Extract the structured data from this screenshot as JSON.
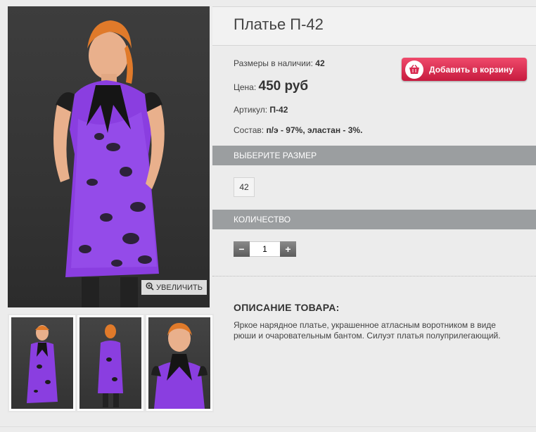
{
  "product": {
    "title": "Платье П-42",
    "sizes_label": "Размеры в наличии:",
    "sizes_value": "42",
    "price_label": "Цена:",
    "price_value": "450 руб",
    "article_label": "Артикул:",
    "article_value": "П-42",
    "composition_label": "Состав:",
    "composition_value": "п/э - 97%, эластан - 3%."
  },
  "cart": {
    "button_label": "Добавить в корзину",
    "icon": "basket-icon"
  },
  "gallery": {
    "zoom_label": "УВЕЛИЧИТЬ",
    "zoom_icon": "magnifier-plus-icon",
    "thumbnail_count": 3
  },
  "size_select": {
    "header": "ВЫБЕРИТЕ РАЗМЕР",
    "options": [
      "42"
    ]
  },
  "quantity": {
    "header": "КОЛИЧЕСТВО",
    "value": "1",
    "minus": "−",
    "plus": "+"
  },
  "description": {
    "header": "ОПИСАНИЕ ТОВАРА:",
    "text": "Яркое нарядное платье, украшенное атласным воротником в виде рюши и очаровательным бантом. Силуэт платья полуприлегающий."
  },
  "colors": {
    "cart_button": "#d92a4f",
    "section_bar": "#9b9ea0",
    "dress_purple": "#8a3ee0"
  }
}
